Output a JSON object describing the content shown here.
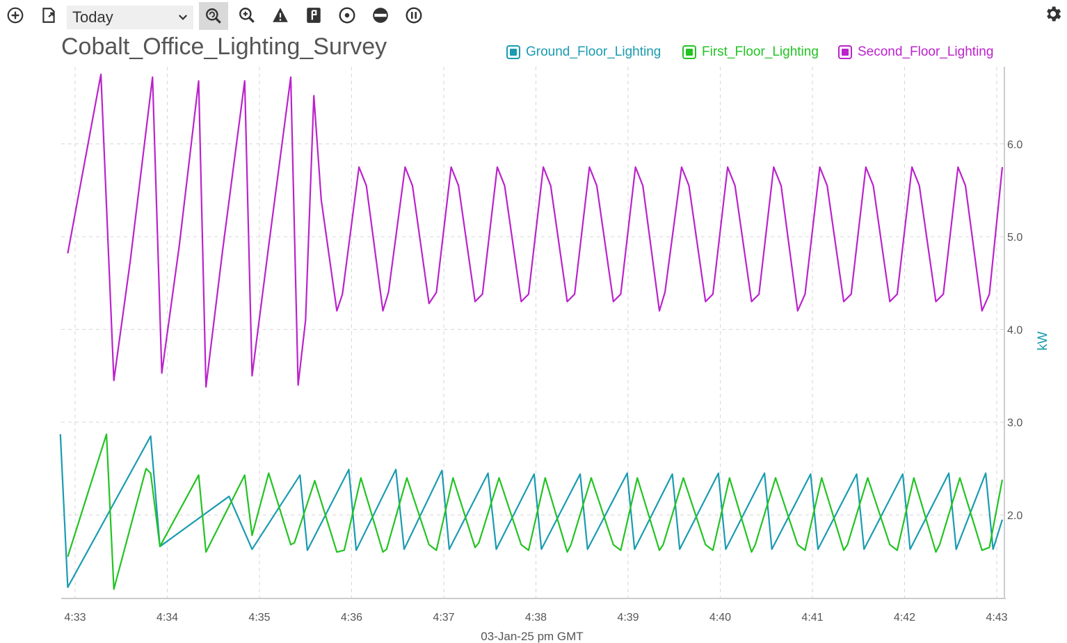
{
  "toolbar": {
    "range_value": "Today",
    "icons": [
      "add-circle-icon",
      "export-icon",
      "zoom-reset-icon",
      "zoom-icon",
      "alert-triangle-icon",
      "flag-icon",
      "target-icon",
      "minus-circle-icon",
      "pause-circle-icon",
      "gear-icon"
    ]
  },
  "colors": {
    "ground": "#1a9bb0",
    "first": "#22c322",
    "second": "#bb22cc"
  },
  "chart_data": {
    "type": "line",
    "title": "Cobalt_Office_Lighting_Survey",
    "xlabel": "03-Jan-25 pm GMT",
    "ylabel": "kW",
    "x_ticks": [
      "4:33",
      "4:34",
      "4:35",
      "4:36",
      "4:37",
      "4:38",
      "4:39",
      "4:40",
      "4:41",
      "4:42",
      "4:43"
    ],
    "y_ticks": [
      "2.0",
      "3.0",
      "4.0",
      "5.0",
      "6.0"
    ],
    "ylim": [
      1.0,
      6.85
    ],
    "xlim_minutes": [
      -0.16,
      10.08
    ],
    "grid": true,
    "legend_position": "top-right",
    "series": [
      {
        "name": "Ground_Floor_Lighting",
        "color": "#1a9bb0",
        "points": [
          [
            -0.16,
            2.87
          ],
          [
            -0.08,
            1.22
          ],
          [
            0.82,
            2.85
          ],
          [
            0.92,
            1.66
          ],
          [
            1.67,
            2.2
          ],
          [
            1.92,
            1.63
          ],
          [
            2.44,
            2.43
          ],
          [
            2.52,
            1.62
          ],
          [
            2.97,
            2.49
          ],
          [
            3.05,
            1.62
          ],
          [
            3.48,
            2.49
          ],
          [
            3.57,
            1.63
          ],
          [
            3.98,
            2.48
          ],
          [
            4.06,
            1.63
          ],
          [
            4.48,
            2.45
          ],
          [
            4.57,
            1.63
          ],
          [
            4.98,
            2.44
          ],
          [
            5.06,
            1.63
          ],
          [
            5.48,
            2.44
          ],
          [
            5.56,
            1.63
          ],
          [
            5.99,
            2.45
          ],
          [
            6.07,
            1.63
          ],
          [
            6.48,
            2.44
          ],
          [
            6.56,
            1.63
          ],
          [
            6.98,
            2.45
          ],
          [
            7.06,
            1.63
          ],
          [
            7.48,
            2.45
          ],
          [
            7.56,
            1.63
          ],
          [
            7.98,
            2.44
          ],
          [
            8.06,
            1.63
          ],
          [
            8.48,
            2.44
          ],
          [
            8.56,
            1.63
          ],
          [
            8.98,
            2.44
          ],
          [
            9.06,
            1.63
          ],
          [
            9.48,
            2.45
          ],
          [
            9.56,
            1.63
          ],
          [
            9.88,
            2.45
          ],
          [
            9.96,
            1.63
          ],
          [
            10.06,
            1.95
          ]
        ]
      },
      {
        "name": "First_Floor_Lighting",
        "color": "#22c322",
        "points": [
          [
            -0.08,
            1.55
          ],
          [
            0.34,
            2.87
          ],
          [
            0.42,
            1.2
          ],
          [
            0.77,
            2.5
          ],
          [
            0.82,
            2.45
          ],
          [
            0.92,
            1.66
          ],
          [
            1.34,
            2.43
          ],
          [
            1.42,
            1.6
          ],
          [
            1.84,
            2.43
          ],
          [
            1.92,
            1.78
          ],
          [
            2.1,
            2.45
          ],
          [
            2.34,
            1.68
          ],
          [
            2.38,
            1.7
          ],
          [
            2.6,
            2.37
          ],
          [
            2.84,
            1.6
          ],
          [
            2.92,
            1.62
          ],
          [
            3.1,
            2.4
          ],
          [
            3.34,
            1.6
          ],
          [
            3.38,
            1.63
          ],
          [
            3.6,
            2.4
          ],
          [
            3.84,
            1.68
          ],
          [
            3.92,
            1.62
          ],
          [
            4.1,
            2.4
          ],
          [
            4.34,
            1.65
          ],
          [
            4.38,
            1.7
          ],
          [
            4.6,
            2.4
          ],
          [
            4.84,
            1.68
          ],
          [
            4.92,
            1.62
          ],
          [
            5.1,
            2.4
          ],
          [
            5.34,
            1.6
          ],
          [
            5.38,
            1.68
          ],
          [
            5.6,
            2.4
          ],
          [
            5.84,
            1.68
          ],
          [
            5.92,
            1.62
          ],
          [
            6.1,
            2.4
          ],
          [
            6.34,
            1.62
          ],
          [
            6.38,
            1.68
          ],
          [
            6.6,
            2.4
          ],
          [
            6.84,
            1.68
          ],
          [
            6.92,
            1.62
          ],
          [
            7.1,
            2.4
          ],
          [
            7.34,
            1.6
          ],
          [
            7.38,
            1.68
          ],
          [
            7.6,
            2.4
          ],
          [
            7.84,
            1.68
          ],
          [
            7.92,
            1.62
          ],
          [
            8.1,
            2.4
          ],
          [
            8.34,
            1.62
          ],
          [
            8.38,
            1.68
          ],
          [
            8.6,
            2.4
          ],
          [
            8.84,
            1.68
          ],
          [
            8.92,
            1.62
          ],
          [
            9.1,
            2.4
          ],
          [
            9.34,
            1.6
          ],
          [
            9.38,
            1.68
          ],
          [
            9.6,
            2.4
          ],
          [
            9.84,
            1.62
          ],
          [
            9.92,
            1.65
          ],
          [
            10.06,
            2.38
          ]
        ]
      },
      {
        "name": "Second_Floor_Lighting",
        "color": "#bb22cc",
        "points": [
          [
            -0.08,
            4.82
          ],
          [
            0.28,
            6.75
          ],
          [
            0.42,
            3.45
          ],
          [
            0.6,
            4.75
          ],
          [
            0.84,
            6.72
          ],
          [
            0.94,
            3.53
          ],
          [
            1.13,
            4.9
          ],
          [
            1.34,
            6.68
          ],
          [
            1.42,
            3.38
          ],
          [
            1.6,
            4.85
          ],
          [
            1.84,
            6.68
          ],
          [
            1.92,
            3.5
          ],
          [
            2.1,
            4.9
          ],
          [
            2.34,
            6.72
          ],
          [
            2.42,
            3.4
          ],
          [
            2.5,
            4.1
          ],
          [
            2.59,
            6.52
          ],
          [
            2.67,
            5.4
          ],
          [
            2.84,
            4.2
          ],
          [
            2.9,
            4.38
          ],
          [
            3.08,
            5.75
          ],
          [
            3.16,
            5.55
          ],
          [
            3.34,
            4.2
          ],
          [
            3.4,
            4.4
          ],
          [
            3.58,
            5.75
          ],
          [
            3.66,
            5.55
          ],
          [
            3.84,
            4.28
          ],
          [
            3.92,
            4.4
          ],
          [
            4.08,
            5.75
          ],
          [
            4.16,
            5.55
          ],
          [
            4.34,
            4.3
          ],
          [
            4.42,
            4.38
          ],
          [
            4.58,
            5.75
          ],
          [
            4.66,
            5.55
          ],
          [
            4.84,
            4.3
          ],
          [
            4.92,
            4.38
          ],
          [
            5.08,
            5.75
          ],
          [
            5.16,
            5.55
          ],
          [
            5.34,
            4.3
          ],
          [
            5.42,
            4.38
          ],
          [
            5.58,
            5.75
          ],
          [
            5.66,
            5.55
          ],
          [
            5.84,
            4.3
          ],
          [
            5.92,
            4.38
          ],
          [
            6.08,
            5.75
          ],
          [
            6.16,
            5.55
          ],
          [
            6.34,
            4.2
          ],
          [
            6.4,
            4.4
          ],
          [
            6.58,
            5.75
          ],
          [
            6.66,
            5.55
          ],
          [
            6.84,
            4.3
          ],
          [
            6.92,
            4.38
          ],
          [
            7.08,
            5.75
          ],
          [
            7.16,
            5.55
          ],
          [
            7.34,
            4.3
          ],
          [
            7.42,
            4.38
          ],
          [
            7.58,
            5.75
          ],
          [
            7.66,
            5.55
          ],
          [
            7.84,
            4.2
          ],
          [
            7.92,
            4.38
          ],
          [
            8.08,
            5.75
          ],
          [
            8.16,
            5.55
          ],
          [
            8.34,
            4.3
          ],
          [
            8.42,
            4.38
          ],
          [
            8.58,
            5.75
          ],
          [
            8.66,
            5.55
          ],
          [
            8.84,
            4.3
          ],
          [
            8.92,
            4.38
          ],
          [
            9.08,
            5.75
          ],
          [
            9.16,
            5.55
          ],
          [
            9.34,
            4.3
          ],
          [
            9.42,
            4.38
          ],
          [
            9.58,
            5.75
          ],
          [
            9.66,
            5.55
          ],
          [
            9.84,
            4.2
          ],
          [
            9.92,
            4.38
          ],
          [
            10.06,
            5.75
          ]
        ]
      }
    ]
  }
}
